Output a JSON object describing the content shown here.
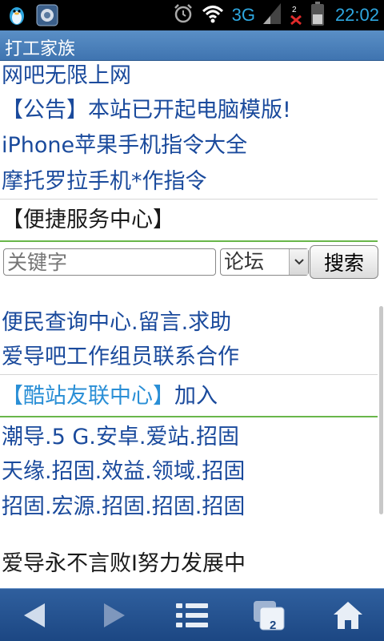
{
  "status_bar": {
    "network": "3G",
    "time": "22:02",
    "notification_badge": "2"
  },
  "title_bar": {
    "title": "打工家族"
  },
  "links_top": [
    "网吧无限上网",
    "【公告】本站已开起电脑模版!",
    "iPhone苹果手机指令大全",
    "摩托罗拉手机*作指令"
  ],
  "service_center": {
    "title": "【便捷服务中心】"
  },
  "search": {
    "placeholder": "关键字",
    "select_value": "论坛",
    "button_label": "搜索"
  },
  "links_middle": [
    "便民查询中心.留言.求助",
    "爱导吧工作组员联系合作"
  ],
  "friend_links": {
    "title": "【酷站友联中心】",
    "join_label": "加入",
    "rows": [
      "潮导.5 G.安卓.爱站.招固",
      "天缘.招固.效益.领域.招固",
      "招固.宏源.招固.招固.招固"
    ]
  },
  "slogan": "爱导永不言败I努力发展中",
  "bottom_bar": {
    "tab_count": "2"
  },
  "colors": {
    "link": "#1a4a9c",
    "title_bar": "#4a80bb",
    "separator_green": "#69b64a",
    "accent_blue": "#2a8fd6"
  }
}
